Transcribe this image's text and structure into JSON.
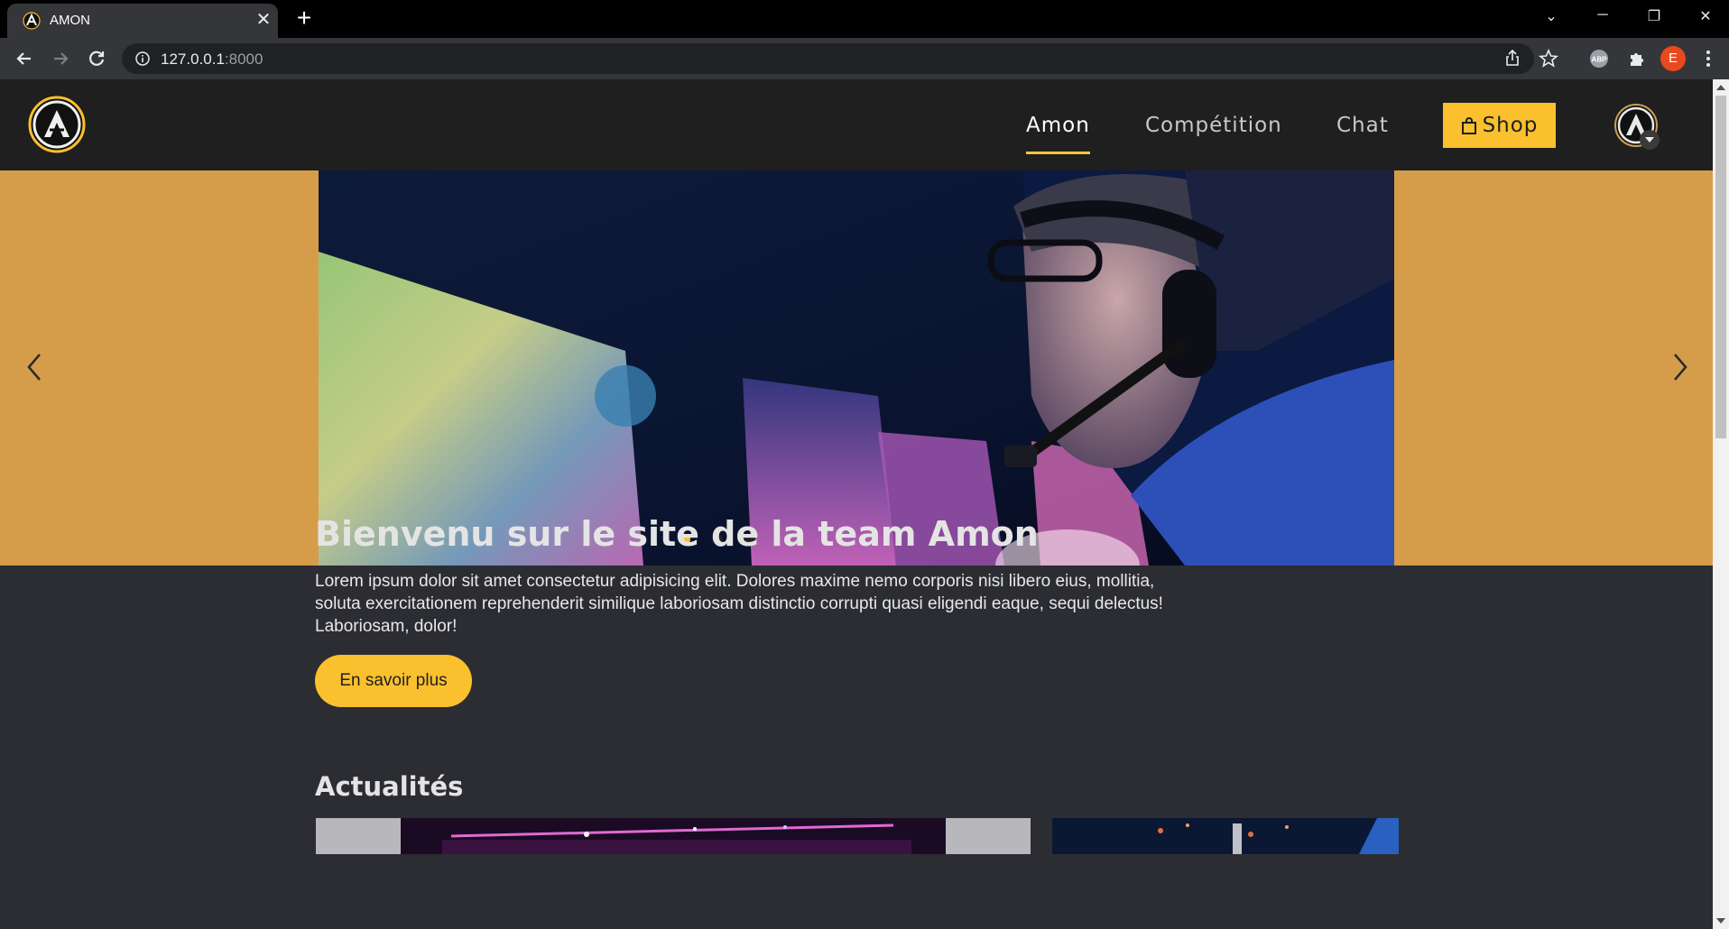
{
  "browser": {
    "tab_title": "AMON",
    "new_tab_label": "+",
    "url_host": "127.0.0.1",
    "url_port": ":8000",
    "profile_initial": "E",
    "extension_label": "ABP"
  },
  "site": {
    "nav": {
      "items": [
        {
          "label": "Amon",
          "active": true
        },
        {
          "label": "Compétition",
          "active": false
        },
        {
          "label": "Chat",
          "active": false
        }
      ],
      "shop_label": "Shop"
    },
    "carousel": {
      "slide_count": 3,
      "active_index": 0
    },
    "hero": {
      "title": "Bienvenu sur le site de la team Amon",
      "text": "Lorem ipsum dolor sit amet consectetur adipisicing elit. Dolores maxime nemo corporis nisi libero eius, mollitia, soluta exercitationem reprehenderit similique laboriosam distinctio corrupti quasi eligendi eaque, sequi delectus! Laboriosam, dolor!",
      "cta_label": "En savoir plus"
    },
    "news": {
      "title": "Actualités"
    }
  },
  "colors": {
    "accent": "#fbc02d",
    "carousel_bg": "#d59d4a",
    "header_bg": "#1f1f1f",
    "page_bg": "#2c2d32"
  }
}
